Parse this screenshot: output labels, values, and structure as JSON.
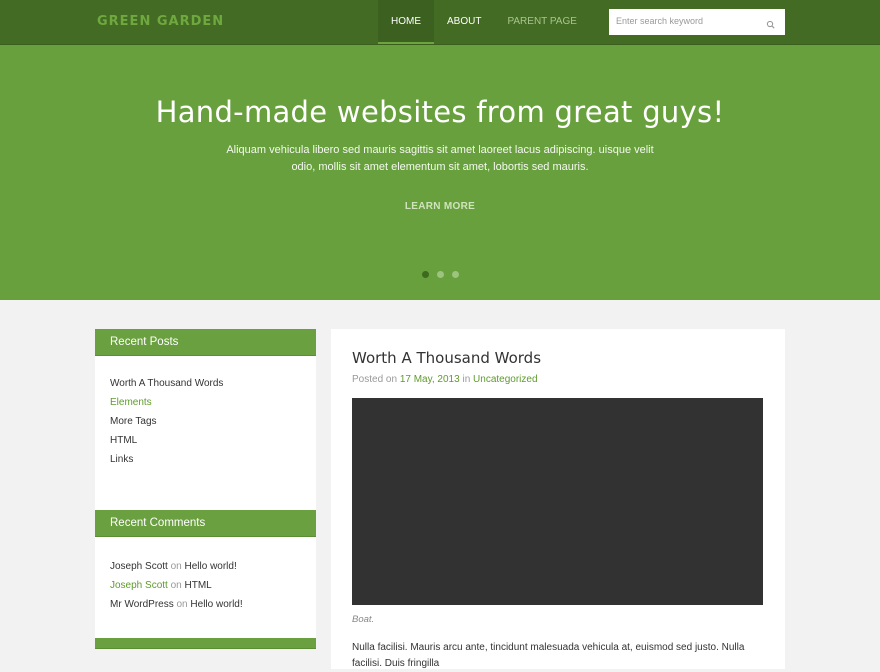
{
  "brand": {
    "logo": "GREEN GARDEN"
  },
  "nav": {
    "items": [
      {
        "label": "HOME"
      },
      {
        "label": "ABOUT"
      },
      {
        "label": "PARENT PAGE"
      }
    ]
  },
  "search": {
    "placeholder": "Enter search keyword"
  },
  "hero": {
    "headline": "Hand-made websites from great guys!",
    "text": "Aliquam vehicula libero sed mauris sagittis sit amet laoreet lacus adipiscing. uisque velit odio, mollis sit amet elementum sit amet, lobortis sed mauris.",
    "cta": "LEARN MORE",
    "slides": 3,
    "active_slide": 1
  },
  "sidebar": {
    "recent_posts": {
      "title": "Recent Posts",
      "items": [
        "Worth A Thousand Words",
        "Elements",
        "More Tags",
        "HTML",
        "Links"
      ]
    },
    "recent_comments": {
      "title": "Recent Comments",
      "items": [
        {
          "author": "Joseph Scott",
          "on": "on",
          "post": "Hello world!"
        },
        {
          "author": "Joseph Scott",
          "on": "on",
          "post": "HTML"
        },
        {
          "author": "Mr WordPress",
          "on": "on",
          "post": "Hello world!"
        }
      ]
    }
  },
  "post": {
    "title": "Worth A Thousand Words",
    "posted_on": "Posted on",
    "date": "17 May, 2013",
    "in": "in",
    "category": "Uncategorized",
    "caption": "Boat.",
    "excerpt": "Nulla facilisi. Mauris arcu ante, tincidunt malesuada vehicula at, euismod sed justo. Nulla facilisi. Duis fringilla"
  },
  "colors": {
    "topbar": "#436b23",
    "hero": "#68a03d",
    "accent": "#5f9b2d",
    "widget_header": "#6aa03f",
    "image_placeholder": "#323232"
  }
}
